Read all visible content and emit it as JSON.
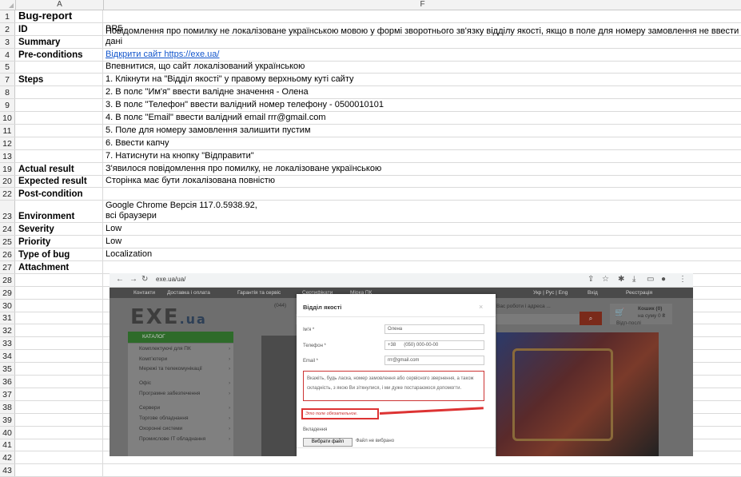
{
  "columns": {
    "a": "A",
    "f": "F"
  },
  "rows": [
    {
      "n": "1",
      "label": "Bug-report",
      "value": ""
    },
    {
      "n": "2",
      "label": "ID",
      "value": "BR5"
    },
    {
      "n": "3",
      "label": "Summary",
      "value": "Повідомлення про помилку не локалізоване українською мовою у формі зворотнього зв'язку відділу якості, якщо в поле для номеру замовлення не ввести дані"
    },
    {
      "n": "4",
      "label": "Pre-conditions",
      "value": "Відкрити сайт https://exe.ua/"
    },
    {
      "n": "5",
      "label": "",
      "value": "Впевнитися, що сайт локалізований українською"
    },
    {
      "n": "7",
      "label": "Steps",
      "value": "1. Клікнути на \"Відділ якості\" у правому верхньому куті сайту"
    },
    {
      "n": "8",
      "label": "",
      "value": "2. В полє \"Им'я\" ввести валідне значення - Олена"
    },
    {
      "n": "9",
      "label": "",
      "value": "3. В полє \"Телефон\" ввести валідний номер телефону - 0500010101"
    },
    {
      "n": "10",
      "label": "",
      "value": "4. В полє \"Email\" ввести валідний email rrr@gmail.com"
    },
    {
      "n": "11",
      "label": "",
      "value": "5. Поле для номеру замовлення залишити пустим"
    },
    {
      "n": "12",
      "label": "",
      "value": "6. Ввести капчу"
    },
    {
      "n": "13",
      "label": "",
      "value": "7. Натиснути на кнопку \"Відправити\""
    },
    {
      "n": "19",
      "label": "Actual result",
      "value": "З'явилося повідомлення про помилку, не локалізоване українською"
    },
    {
      "n": "20",
      "label": "Expected result",
      "value": "Сторінка має бути локалізована повністю"
    },
    {
      "n": "22",
      "label": "Post-condition",
      "value": ""
    },
    {
      "n": "23",
      "label": "Environment",
      "value": "Google Chrome Версія 117.0.5938.92,\nвсі браузери"
    },
    {
      "n": "24",
      "label": "Severity",
      "value": "Low"
    },
    {
      "n": "25",
      "label": "Priority",
      "value": "Low"
    },
    {
      "n": "26",
      "label": "Type of bug",
      "value": "Localization"
    },
    {
      "n": "27",
      "label": "Attachment",
      "value": ""
    },
    {
      "n": "28",
      "label": "",
      "value": ""
    },
    {
      "n": "29",
      "label": "",
      "value": ""
    },
    {
      "n": "30",
      "label": "",
      "value": ""
    },
    {
      "n": "31",
      "label": "",
      "value": ""
    },
    {
      "n": "32",
      "label": "",
      "value": ""
    },
    {
      "n": "33",
      "label": "",
      "value": ""
    },
    {
      "n": "34",
      "label": "",
      "value": ""
    },
    {
      "n": "35",
      "label": "",
      "value": ""
    },
    {
      "n": "36",
      "label": "",
      "value": ""
    },
    {
      "n": "37",
      "label": "",
      "value": ""
    },
    {
      "n": "38",
      "label": "",
      "value": ""
    },
    {
      "n": "39",
      "label": "",
      "value": ""
    },
    {
      "n": "40",
      "label": "",
      "value": ""
    },
    {
      "n": "41",
      "label": "",
      "value": ""
    },
    {
      "n": "42",
      "label": "",
      "value": ""
    },
    {
      "n": "43",
      "label": "",
      "value": ""
    }
  ],
  "precond_link": {
    "prefix": "Відкрити сайт ",
    "url": "https://exe.ua/"
  },
  "attachment": {
    "browser_url": "exe.ua/ua/",
    "topnav": [
      "Контакти",
      "Доставка і оплата",
      "Гарантія та сервіс",
      "Сертифікати",
      "Мірка ПК"
    ],
    "topnav_right": [
      "Укр | Рус | Eng",
      "Вхід",
      "Реєстрація"
    ],
    "phone": "(044)",
    "search_hint": "Вас роботи і адреса ...",
    "logo_main": "EXE",
    "logo_suffix": ".ua",
    "catalog": "КАТАЛОГ",
    "menu": [
      "Комплектуючі для ПК",
      "Комп'ютери",
      "Мережі та телекомунікації",
      "Офіс",
      "Програмне забезпечення",
      "Сервери",
      "Торгове обладнання",
      "Охоронні системи",
      "Промислове IT обладнання"
    ],
    "cart": {
      "title": "Кошик (0)",
      "sum": "на суму 0 ₴",
      "link": "Відп-послі"
    },
    "modal": {
      "title": "Відділ якості",
      "close": "×",
      "name_label": "Ім'я *",
      "name_value": "Олена",
      "phone_label": "Телефон *",
      "phone_code": "+38",
      "phone_value": "(050) 000-00-00",
      "email_label": "Email *",
      "email_value": "rrr@gmail.com",
      "textarea": "Вкажіть, будь ласка, номер замовлення або сервісного звернення, а також складність, з якою Ви зіткнулися, і ми дуже постараємося допомогти.",
      "error": "Это поле обязательное.",
      "attach_label": "Вкладення",
      "file_button": "Вибрати файл",
      "file_none": "Файл не вибрано"
    }
  }
}
